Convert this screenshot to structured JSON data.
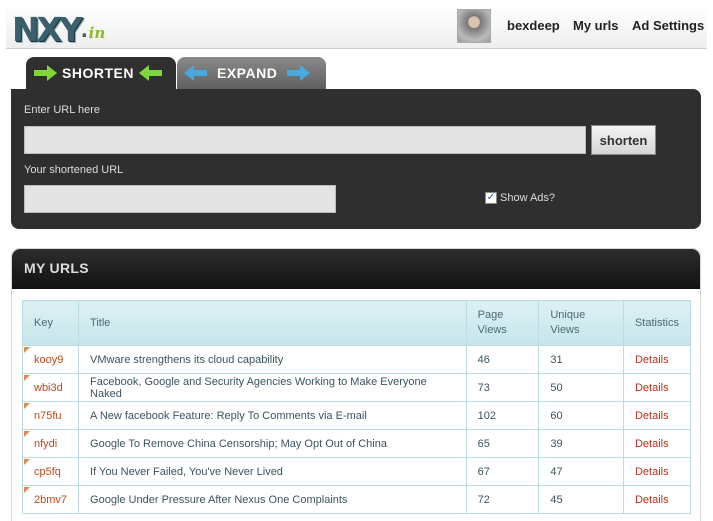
{
  "header": {
    "logo_main": "NXY",
    "logo_dot": ".",
    "logo_tld": "in",
    "username": "bexdeep",
    "nav": [
      "My urls",
      "Ad Settings"
    ]
  },
  "tabs": [
    {
      "label": "SHORTEN",
      "active": true
    },
    {
      "label": "EXPAND",
      "active": false
    }
  ],
  "shorten_panel": {
    "url_label": "Enter URL here",
    "url_value": "",
    "button_label": "shorten",
    "short_label": "Your shortened URL",
    "short_value": "",
    "show_ads_label": "Show Ads?",
    "show_ads_checked": true
  },
  "my_urls": {
    "title": "MY URLS",
    "columns": [
      "Key",
      "Title",
      "Page Views",
      "Unique Views",
      "Statistics"
    ],
    "rows": [
      {
        "key": "kooy9",
        "title": "VMware strengthens its cloud capability",
        "page_views": "46",
        "unique_views": "31",
        "stats": "Details"
      },
      {
        "key": "wbi3d",
        "title": "Facebook, Google and Security Agencies Working to Make Everyone Naked",
        "page_views": "73",
        "unique_views": "50",
        "stats": "Details"
      },
      {
        "key": "n75fu",
        "title": "A New facebook Feature: Reply To Comments via E-mail",
        "page_views": "102",
        "unique_views": "60",
        "stats": "Details"
      },
      {
        "key": "nfydi",
        "title": "Google To Remove China Censorship; May Opt Out of China",
        "page_views": "65",
        "unique_views": "39",
        "stats": "Details"
      },
      {
        "key": "cp5fq",
        "title": "If You Never Failed, You've Never Lived",
        "page_views": "67",
        "unique_views": "47",
        "stats": "Details"
      },
      {
        "key": "2bmv7",
        "title": "Google Under Pressure After Nexus One Complaints",
        "page_views": "72",
        "unique_views": "45",
        "stats": "Details"
      }
    ]
  },
  "colors": {
    "panel_bg": "#2f2f2f",
    "logo": "#3c5f6e",
    "logo_tld": "#8cb82b",
    "table_header": "#c5e6ec",
    "key_link": "#c04a1a",
    "details_link": "#c0301a"
  }
}
